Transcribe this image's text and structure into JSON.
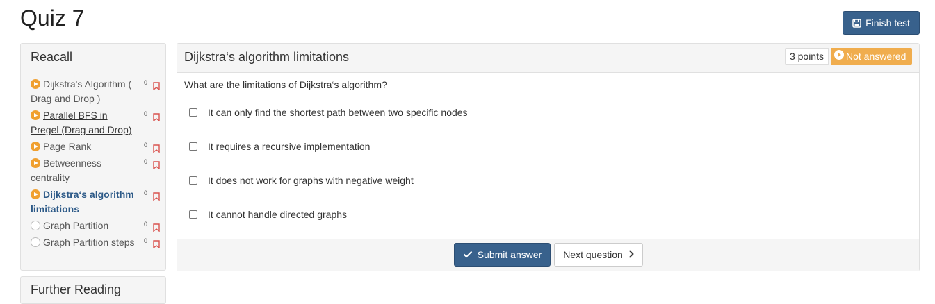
{
  "page": {
    "title": "Quiz 7"
  },
  "header": {
    "finish_label": "Finish test"
  },
  "sidebar": {
    "title": "Reacall",
    "items": [
      {
        "label": "Dijkstra's Algorithm ( Drag and Drop )",
        "count": "0",
        "status": "in-progress",
        "active": false,
        "linked": false
      },
      {
        "label": "Parallel BFS in Pregel (Drag and Drop)",
        "count": "0",
        "status": "in-progress",
        "active": false,
        "linked": true
      },
      {
        "label": "Page Rank",
        "count": "0",
        "status": "in-progress",
        "active": false,
        "linked": false
      },
      {
        "label": "Betweenness centrality",
        "count": "0",
        "status": "in-progress",
        "active": false,
        "linked": false
      },
      {
        "label": "Dijkstra‘s algorithm limitations",
        "count": "0",
        "status": "in-progress",
        "active": true,
        "linked": false
      },
      {
        "label": "Graph Partition",
        "count": "0",
        "status": "not-started",
        "active": false,
        "linked": false
      },
      {
        "label": "Graph Partition steps",
        "count": "0",
        "status": "not-started",
        "active": false,
        "linked": false
      }
    ]
  },
  "sidebar2": {
    "title": "Further Reading"
  },
  "question": {
    "title": "Dijkstra‘s algorithm limitations",
    "points": "3 points",
    "status": "Not answered",
    "text": "What are the limitations of Dijkstra‘s algorithm?",
    "options": [
      "It can only find the shortest path between two specific nodes",
      "It requires a recursive implementation",
      "It does not work for graphs with negative weight",
      "It cannot handle directed graphs"
    ]
  },
  "footer": {
    "submit_label": "Submit answer",
    "next_label": "Next question"
  },
  "colors": {
    "primary": "#38618c",
    "warning": "#f0ad4e",
    "active_link": "#2d5a88",
    "bookmark": "#d9534f"
  }
}
